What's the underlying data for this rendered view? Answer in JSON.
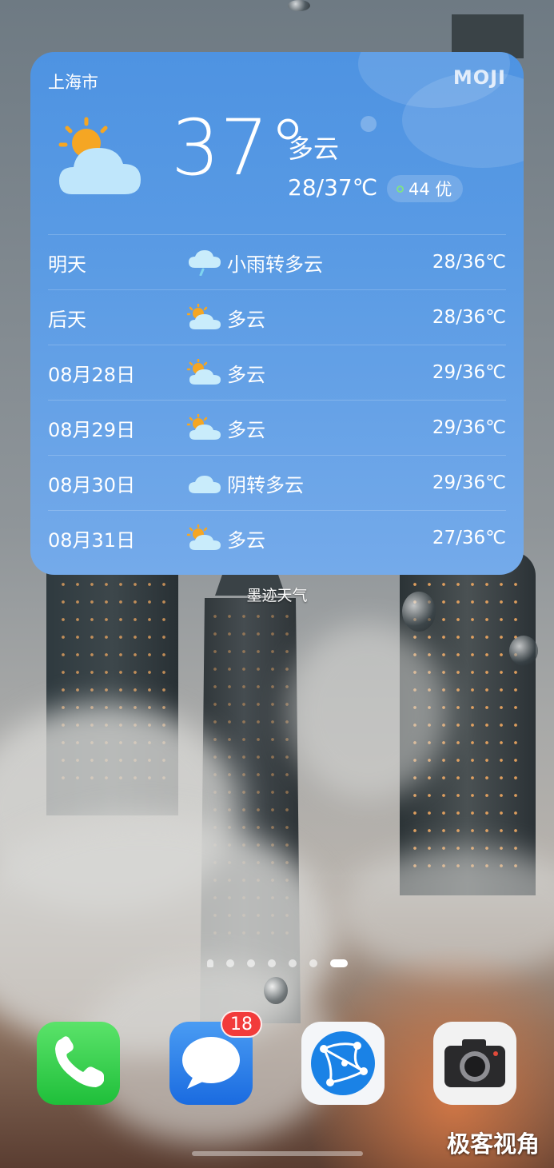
{
  "widget": {
    "city": "上海市",
    "brand": "MOJI",
    "current_temp": "37°",
    "condition": "多云",
    "range": "28/37℃",
    "aqi": "44 优",
    "forecast": [
      {
        "day": "明天",
        "icon": "rain-cloud-icon",
        "desc": "小雨转多云",
        "temp": "28/36℃"
      },
      {
        "day": "后天",
        "icon": "partly-cloudy-icon",
        "desc": "多云",
        "temp": "28/36℃"
      },
      {
        "day": "08月28日",
        "icon": "partly-cloudy-icon",
        "desc": "多云",
        "temp": "29/36℃"
      },
      {
        "day": "08月29日",
        "icon": "partly-cloudy-icon",
        "desc": "多云",
        "temp": "29/36℃"
      },
      {
        "day": "08月30日",
        "icon": "cloud-icon",
        "desc": "阴转多云",
        "temp": "29/36℃"
      },
      {
        "day": "08月31日",
        "icon": "partly-cloudy-icon",
        "desc": "多云",
        "temp": "27/36℃"
      }
    ],
    "label": "墨迹天气"
  },
  "pager": {
    "count": 7,
    "active_index": 6
  },
  "dock": {
    "apps": [
      {
        "name": "phone",
        "icon": "phone-icon"
      },
      {
        "name": "messages",
        "icon": "message-bubble-icon",
        "badge": "18"
      },
      {
        "name": "browser",
        "icon": "browser-globe-icon"
      },
      {
        "name": "camera",
        "icon": "camera-icon"
      }
    ]
  },
  "watermark": "极客视角",
  "colors": {
    "widget_top": "#4e93e2",
    "widget_bottom": "#74aaea",
    "badge": "#f23b3b",
    "aqi_dot": "#7ee08a"
  }
}
